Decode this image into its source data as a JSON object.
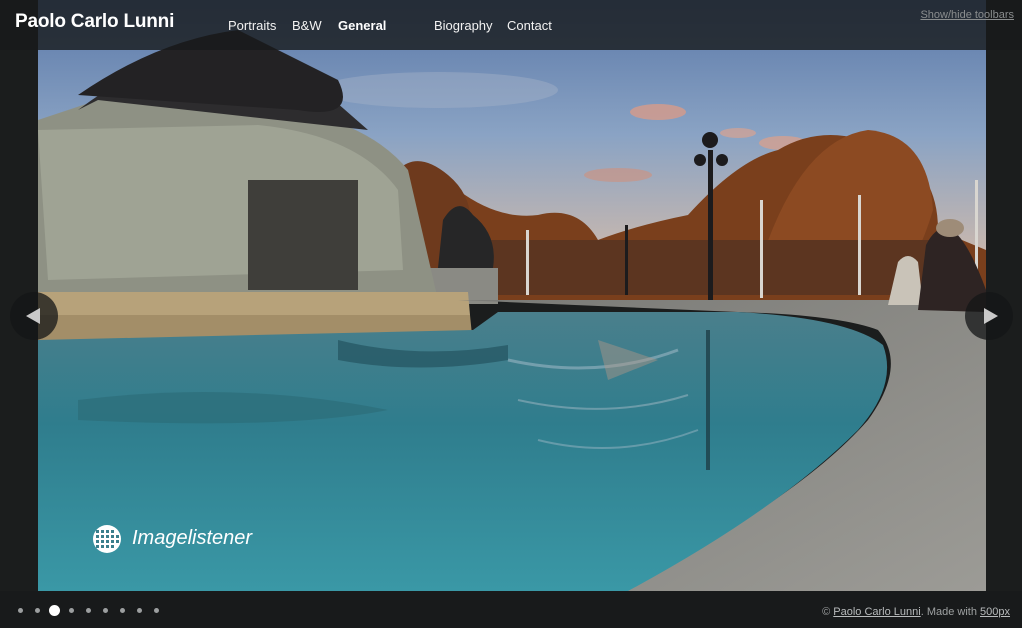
{
  "site": {
    "title": "Paolo Carlo Lunni"
  },
  "nav": {
    "items": [
      {
        "label": "Portraits",
        "active": false
      },
      {
        "label": "B&W",
        "active": false
      },
      {
        "label": "General",
        "active": true
      },
      {
        "label": "Biography",
        "active": false
      },
      {
        "label": "Contact",
        "active": false
      }
    ]
  },
  "toolbar": {
    "toggle_label": "Show/hide toolbars"
  },
  "gallery": {
    "photo_icon": "photo-fountain-london",
    "watermark_text": "Imagelistener",
    "slide_count": 9,
    "active_slide": 3,
    "prev_icon": "arrow-left-icon",
    "next_icon": "arrow-right-icon"
  },
  "footer": {
    "copyright_symbol": "©",
    "author_link": "Paolo Carlo Lunni",
    "made_with_text": ". Made with",
    "platform_link": "500px"
  },
  "colors": {
    "bar_bg": "#181a1b",
    "text": "#ffffff",
    "muted": "#9ea1a2"
  }
}
